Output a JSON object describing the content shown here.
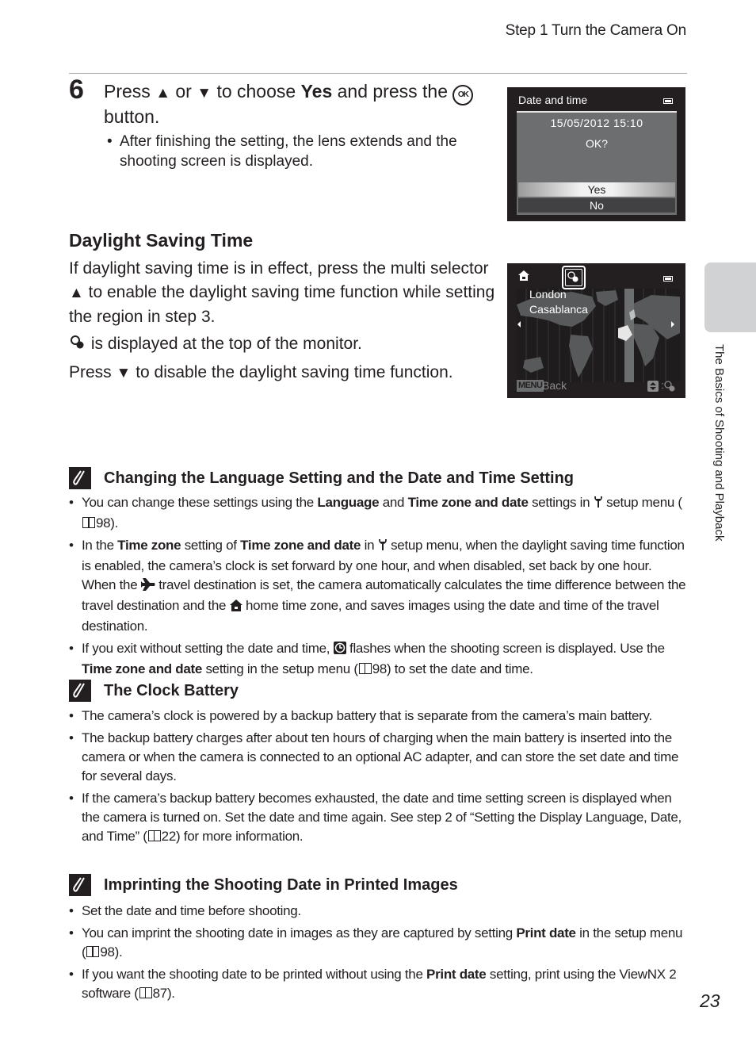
{
  "running_head": "Step 1 Turn the Camera On",
  "step": {
    "number": "6",
    "title_parts": [
      "Press",
      "or",
      "to choose",
      "Yes",
      "and press the",
      "button."
    ],
    "up_icon": "up-triangle-icon",
    "down_icon": "down-triangle-icon",
    "ok_icon_label": "OK",
    "bullets": [
      "After finishing the setting, the lens extends and the shooting screen is displayed."
    ]
  },
  "camera_screen_1": {
    "title": "Date and time",
    "battery_icon": "battery-icon",
    "datetime": "15/05/2012  15:10",
    "prompt": "OK?",
    "options": [
      "Yes",
      "No"
    ],
    "selected": "Yes"
  },
  "camera_screen_2": {
    "home_icon": "home-icon",
    "dst_icon": "daylight-saving-icon",
    "cities": [
      "London",
      "Casablanca"
    ],
    "menu_key": "MENU",
    "back_label": "Back",
    "hint_separator": ":"
  },
  "dst_section": {
    "title": "Daylight Saving Time",
    "para1_a": "If daylight saving time is in effect, press the multi selector",
    "para1_b": "to enable the daylight saving time function while setting the region in step 3.",
    "para2": "is displayed at the top of the monitor.",
    "para3_a": "Press",
    "para3_b": "to disable the daylight saving time function."
  },
  "side_tab": {
    "label": "The Basics of Shooting and Playback"
  },
  "notes": [
    {
      "title": "Changing the Language Setting and the Date and Time Setting",
      "items": [
        [
          "You can change these settings using the ",
          "Language",
          " and ",
          "Time zone and date",
          " settings in ",
          "setup menu (",
          "98)."
        ],
        [
          "In the ",
          "Time zone",
          " setting of ",
          "Time zone and date",
          " in ",
          "setup menu, when the daylight saving time function is enabled, the camera’s clock is set forward by one hour, and when disabled, set back by one hour. When the ",
          "travel destination is set, the camera automatically calculates the time difference between the travel destination and the ",
          "home time zone, and saves images using the date and time of the travel destination."
        ],
        [
          "If you exit without setting the date and time, ",
          "flashes when the shooting screen is displayed. Use the ",
          "Time zone and date",
          " setting in the setup menu (",
          "98) to set the date and time."
        ]
      ]
    },
    {
      "title": "The Clock Battery",
      "items": [
        "The camera’s clock is powered by a backup battery that is separate from the camera’s main battery.",
        "The backup battery charges after about ten hours of charging when the main battery is inserted into the camera or when the camera is connected to an optional AC adapter, and can store the set date and time for several days.",
        [
          "If the camera’s backup battery becomes exhausted, the date and time setting screen is displayed when the camera is turned on. Set the date and time again. See step 2 of “Setting the Display Language, Date, and Time” (",
          "22) for more information."
        ]
      ]
    },
    {
      "title": "Imprinting the Shooting Date in Printed Images",
      "items": [
        "Set the date and time before shooting.",
        [
          "You can imprint the shooting date in images as they are captured by setting ",
          "Print date",
          " in the setup menu (",
          "98)."
        ],
        [
          "If you want the shooting date to be printed without using the ",
          "Print date",
          " setting, print using the ViewNX 2 software (",
          "87)."
        ]
      ]
    }
  ],
  "page_number": "23"
}
